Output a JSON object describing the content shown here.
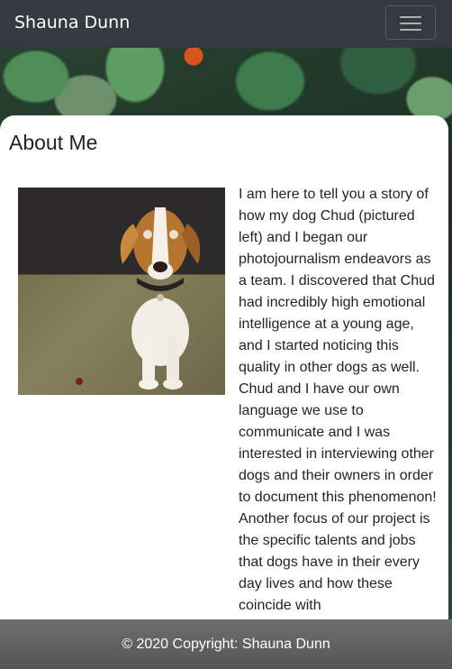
{
  "navbar": {
    "brand": "Shauna Dunn",
    "toggle_icon": "hamburger-menu-icon"
  },
  "main": {
    "heading": "About Me",
    "bio": "I am here to tell you a story of how my dog Chud (pictured left) and I began our photojournalism endeavors as a team. I discovered that Chud had incredibly high emotional intelligence at a young age, and I started noticing this quality in other dogs as well. Chud and I have our own language we use to communicate and I was interested in interviewing other dogs and their owners in order to document this phenomenon! Another focus of our project is the specific talents and jobs that dogs have in their every day lives and how these coincide with"
  },
  "footer": {
    "copyright": "© 2020 Copyright: Shauna Dunn"
  },
  "colors": {
    "navbar_bg": "#343a40",
    "footer_bg": "#5f5f5f",
    "card_bg": "#ffffff"
  }
}
